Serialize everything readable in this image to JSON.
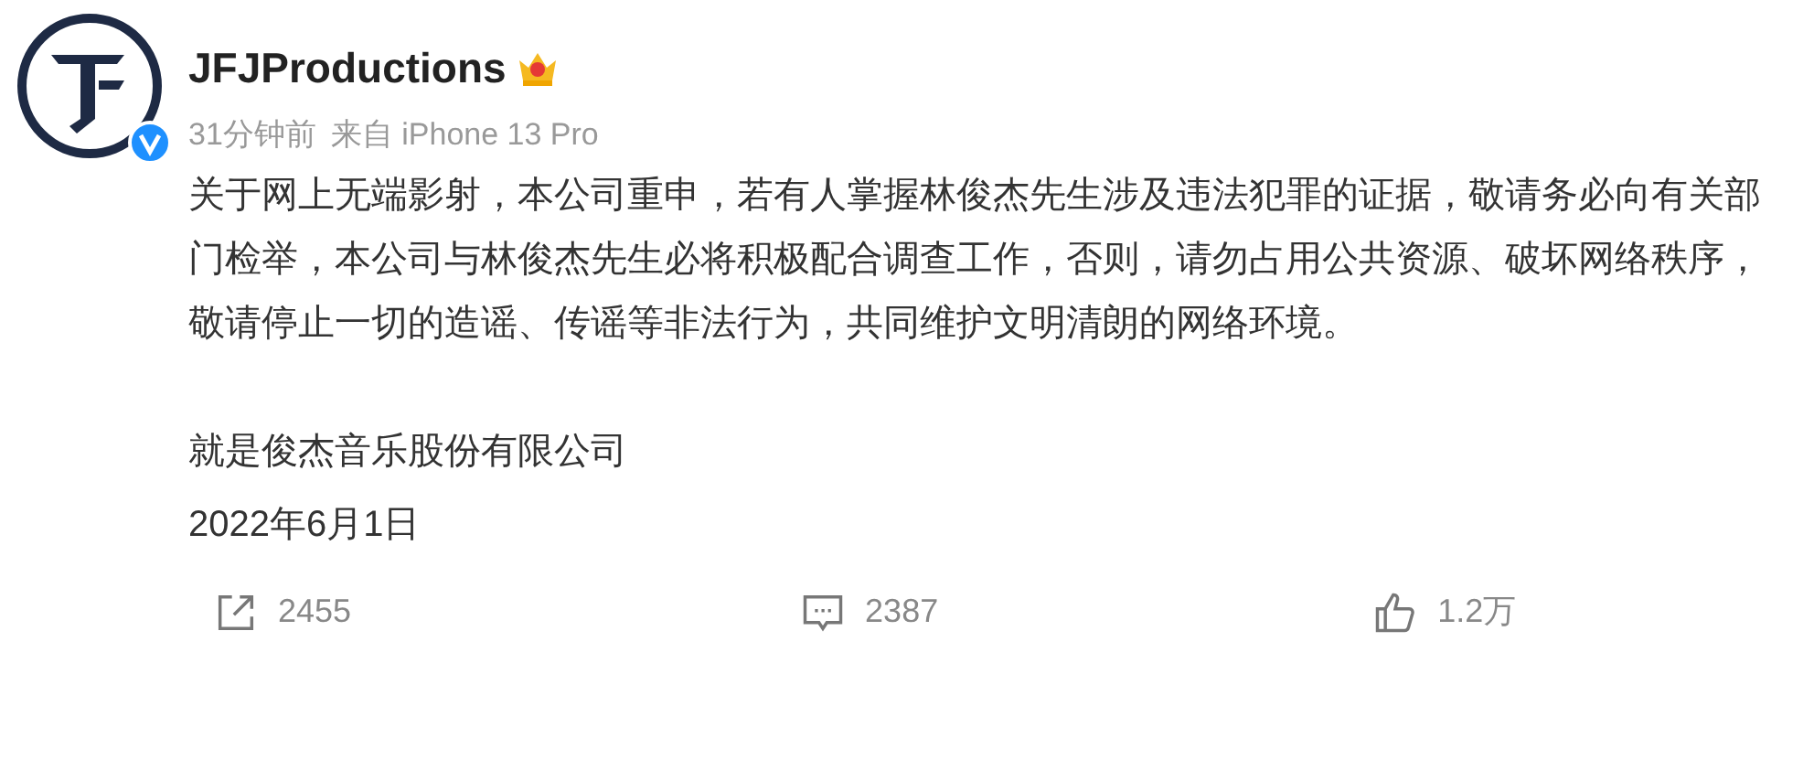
{
  "author": {
    "name": "JFJProductions",
    "verified": true,
    "vip": true
  },
  "meta": {
    "time": "31分钟前",
    "source": "来自 iPhone 13 Pro"
  },
  "body": [
    "关于网上无端影射，本公司重申，若有人掌握林俊杰先生涉及违法犯罪的证据，敬请务必向有关部门检举，本公司与林俊杰先生必将积极配合调查工作，否则，请勿占用公共资源、破坏网络秩序，敬请停止一切的造谣、传谣等非法行为，共同维护文明清朗的网络环境。"
  ],
  "signature": [
    "就是俊杰音乐股份有限公司",
    "2022年6月1日"
  ],
  "actions": [
    {
      "kind": "share",
      "count": "2455"
    },
    {
      "kind": "comment",
      "count": "2387"
    },
    {
      "kind": "like",
      "count": "1.2万"
    }
  ]
}
